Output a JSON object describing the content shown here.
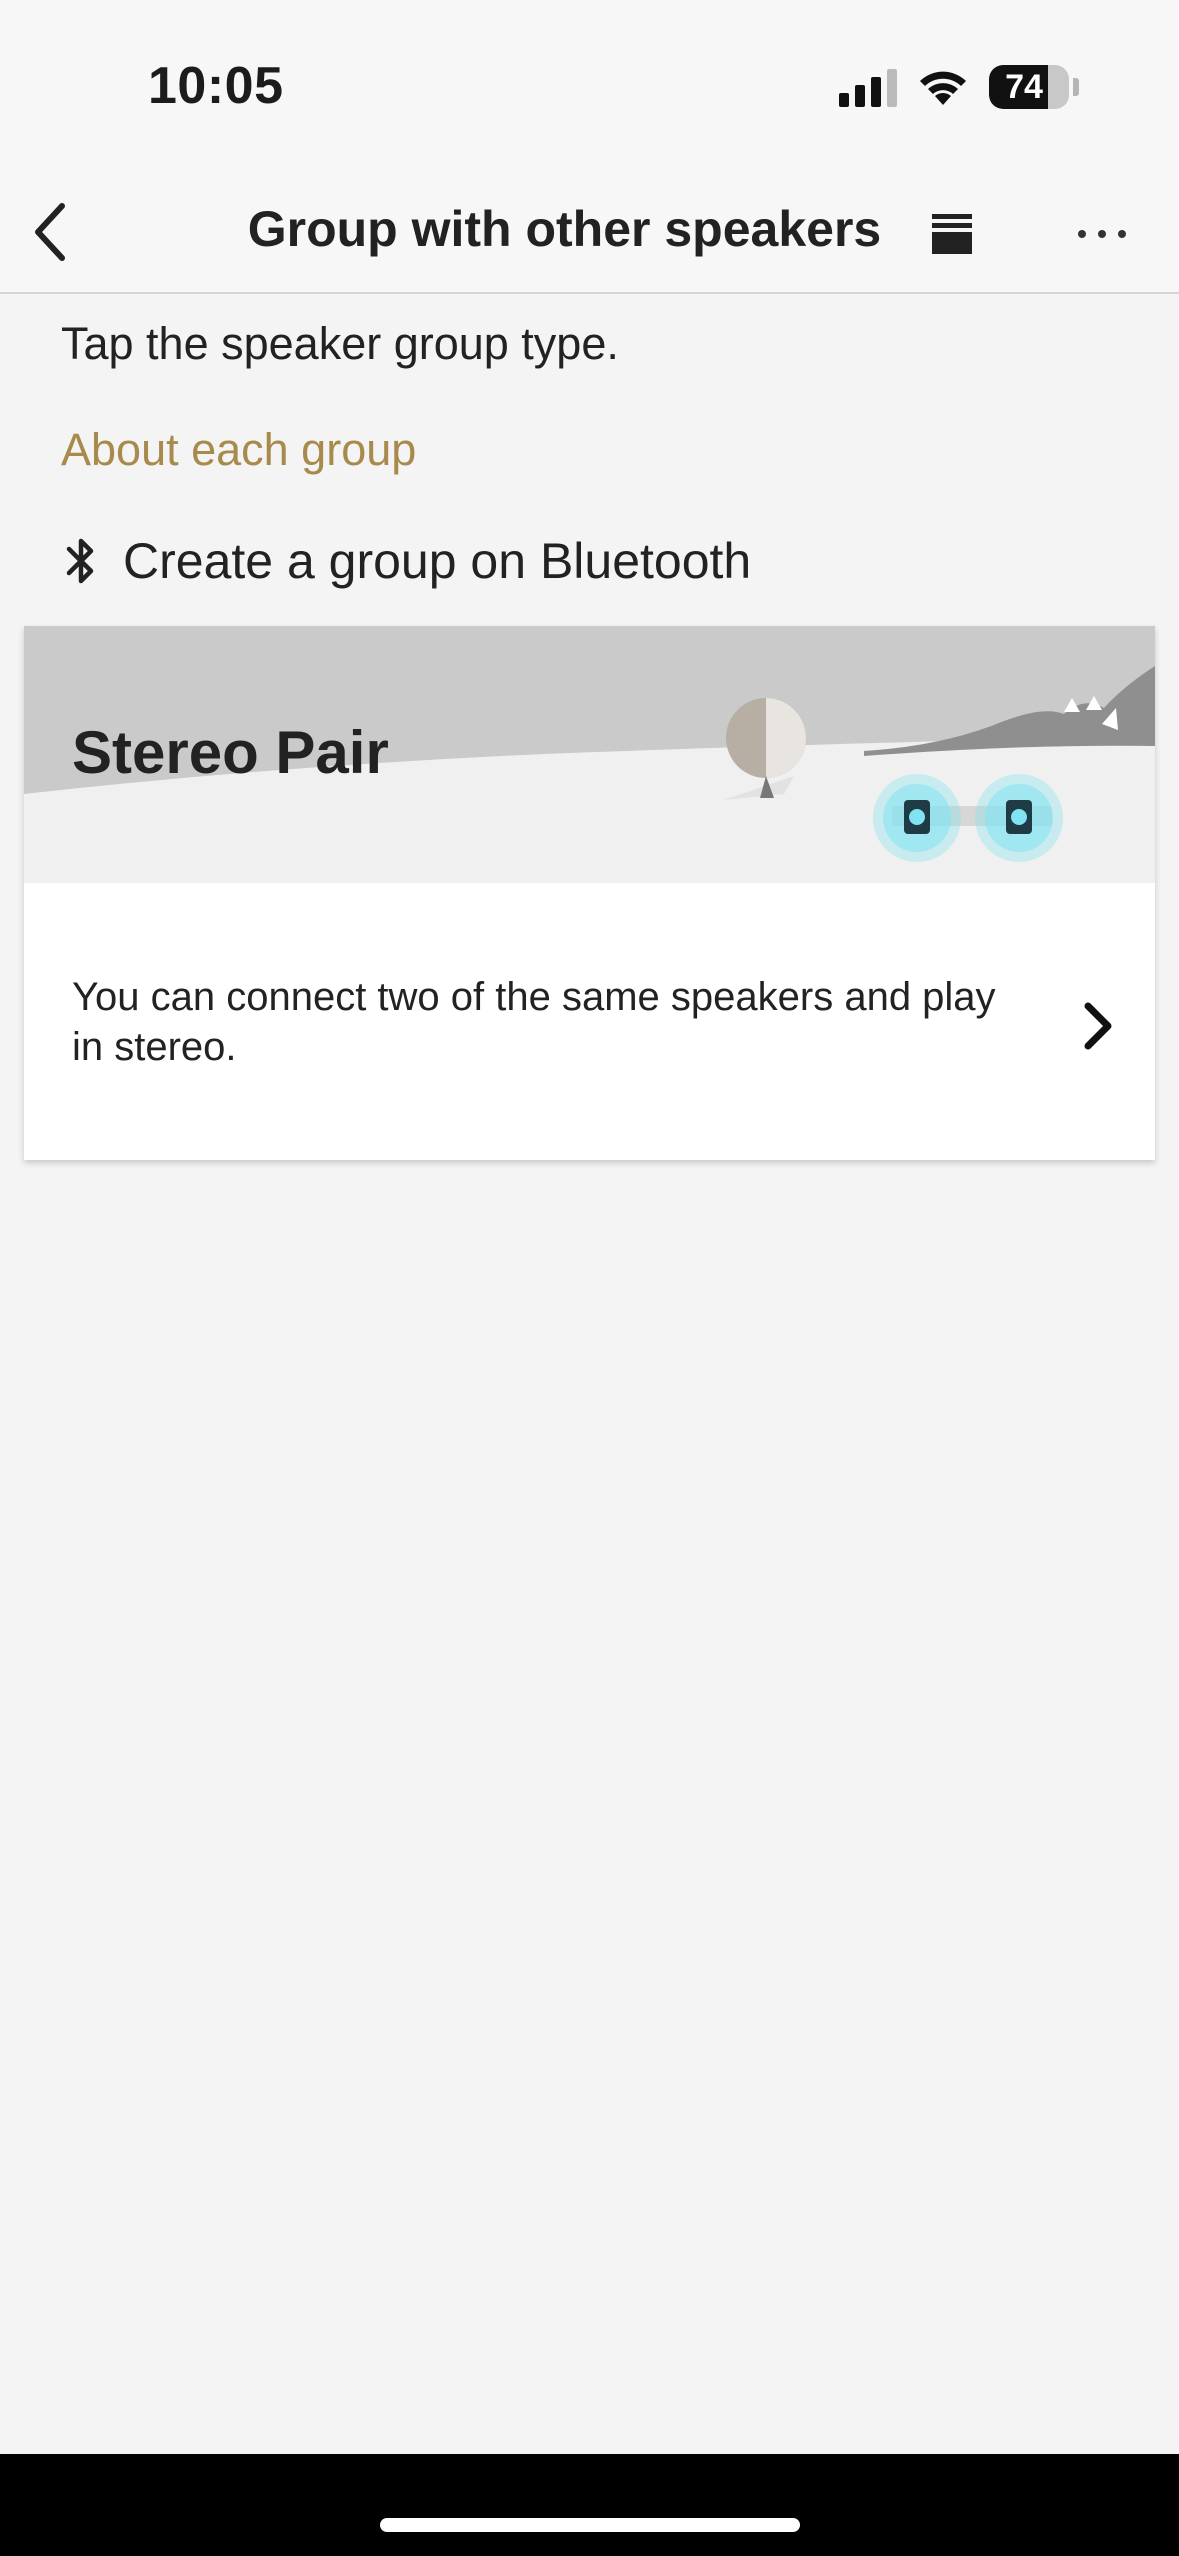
{
  "status_bar": {
    "time": "10:05",
    "battery_level": "74",
    "icons": [
      "signal-icon",
      "wifi-icon",
      "battery-icon"
    ]
  },
  "nav": {
    "title": "Group with other speakers",
    "back_icon": "chevron-left-icon",
    "queue_icon": "queue-icon",
    "more_icon": "more-horizontal-icon"
  },
  "content": {
    "instructions": "Tap the speaker group type.",
    "about_link": "About each group",
    "bluetooth_label": "Create a group on Bluetooth",
    "bluetooth_icon": "bluetooth-icon"
  },
  "groups": [
    {
      "title": "Stereo Pair",
      "description": "You can connect two of the same speakers and play in stereo.",
      "chevron_icon": "chevron-right-icon"
    }
  ],
  "colors": {
    "accent_link": "#a88a4d",
    "background": "#f4f4f4",
    "banner": "#cacaca",
    "speaker_glow": "#7fe3f2"
  }
}
